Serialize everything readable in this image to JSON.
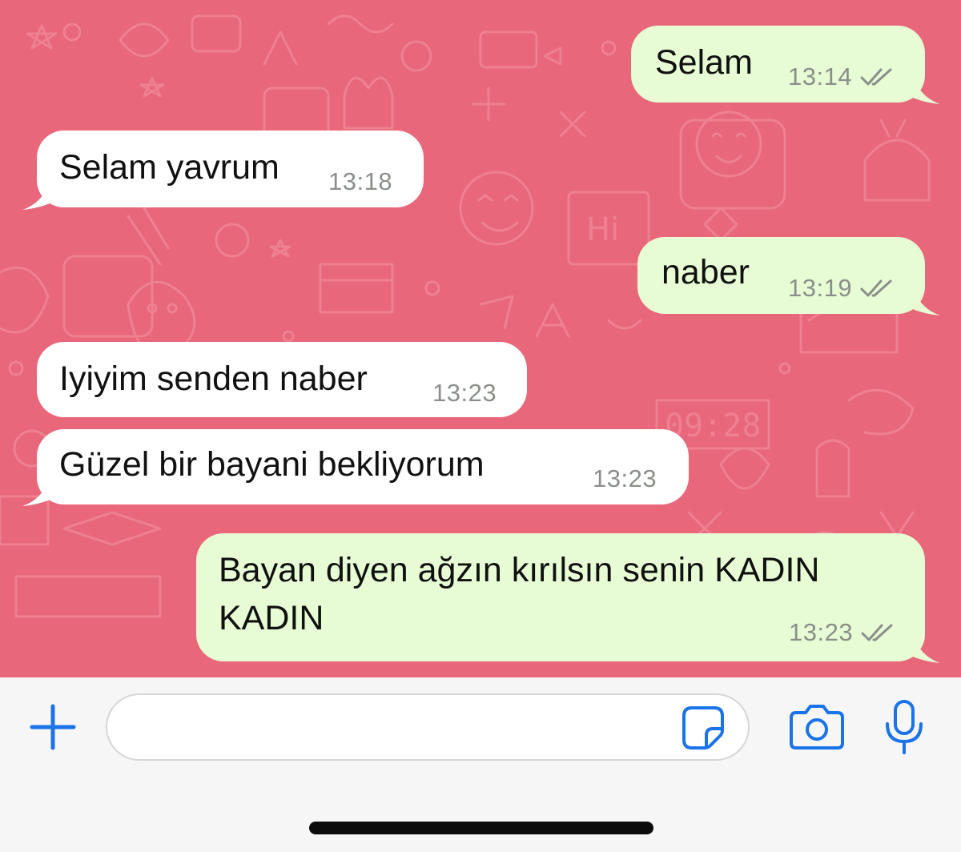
{
  "colors": {
    "wallpaper": "#e8677a",
    "incoming_bubble": "#ffffff",
    "outgoing_bubble": "#e7fcd4",
    "timestamp": "#8a8f8a",
    "accent_icons": "#1a73e8",
    "composer_bg": "#f6f6f6"
  },
  "messages": [
    {
      "direction": "outgoing",
      "text": "Selam",
      "time": "13:14",
      "status": "read-double-check"
    },
    {
      "direction": "incoming",
      "text": "Selam yavrum",
      "time": "13:18"
    },
    {
      "direction": "outgoing",
      "text": "naber",
      "time": "13:19",
      "status": "read-double-check"
    },
    {
      "direction": "incoming",
      "text": "Iyiyim senden naber",
      "time": "13:23"
    },
    {
      "direction": "incoming",
      "text": "Güzel bir bayani bekliyorum",
      "time": "13:23"
    },
    {
      "direction": "outgoing",
      "text_line1": "Bayan diyen ağzın kırılsın senin KADIN",
      "text_line2": "KADIN",
      "time": "13:23",
      "status": "read-double-check"
    }
  ],
  "composer": {
    "input_value": "",
    "icons": [
      "plus-icon",
      "sticker-icon",
      "camera-icon",
      "microphone-icon"
    ]
  }
}
